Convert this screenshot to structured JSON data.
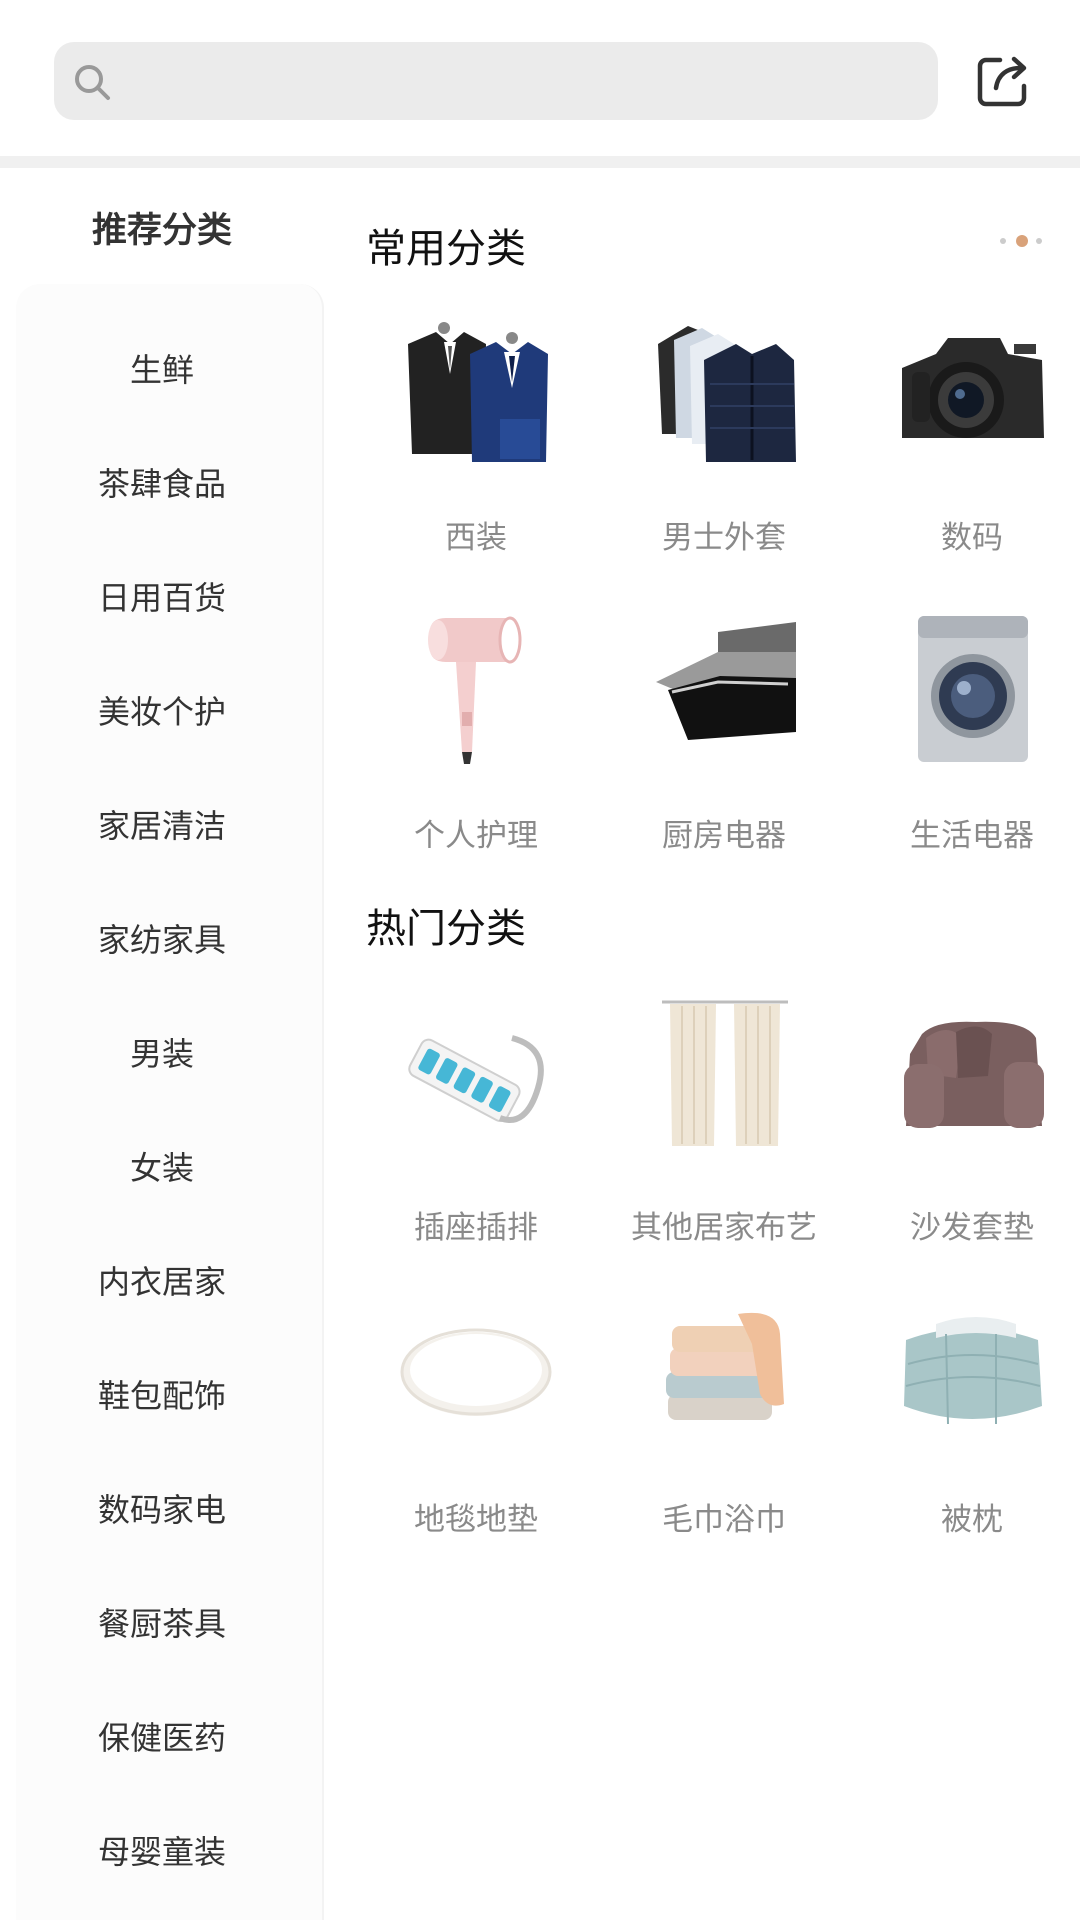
{
  "search": {
    "placeholder": ""
  },
  "sidebar": {
    "title": "推荐分类",
    "items": [
      {
        "label": "生鲜"
      },
      {
        "label": "茶肆食品"
      },
      {
        "label": "日用百货"
      },
      {
        "label": "美妆个护"
      },
      {
        "label": "家居清洁"
      },
      {
        "label": "家纺家具"
      },
      {
        "label": "男装"
      },
      {
        "label": "女装"
      },
      {
        "label": "内衣居家"
      },
      {
        "label": "鞋包配饰"
      },
      {
        "label": "数码家电"
      },
      {
        "label": "餐厨茶具"
      },
      {
        "label": "保健医药"
      },
      {
        "label": "母婴童装"
      }
    ]
  },
  "sections": [
    {
      "title": "常用分类",
      "items": [
        {
          "label": "西装",
          "icon": "suit-icon"
        },
        {
          "label": "男士外套",
          "icon": "jacket-icon"
        },
        {
          "label": "数码",
          "icon": "camera-icon"
        },
        {
          "label": "个人护理",
          "icon": "hair-dryer-icon"
        },
        {
          "label": "厨房电器",
          "icon": "range-hood-icon"
        },
        {
          "label": "生活电器",
          "icon": "washing-machine-icon"
        }
      ]
    },
    {
      "title": "热门分类",
      "items": [
        {
          "label": "插座插排",
          "icon": "power-strip-icon"
        },
        {
          "label": "其他居家布艺",
          "icon": "curtain-icon"
        },
        {
          "label": "沙发套垫",
          "icon": "sofa-icon"
        },
        {
          "label": "地毯地垫",
          "icon": "rug-icon"
        },
        {
          "label": "毛巾浴巾",
          "icon": "towel-icon"
        },
        {
          "label": "被枕",
          "icon": "quilt-icon"
        }
      ]
    }
  ],
  "colors": {
    "accent_dot": "#d9a27a",
    "inactive_dot": "#cccccc",
    "label_gray": "#8a8a8a",
    "search_bg": "#ebebeb"
  },
  "carousel": {
    "active_page": 2,
    "pages": 3
  }
}
